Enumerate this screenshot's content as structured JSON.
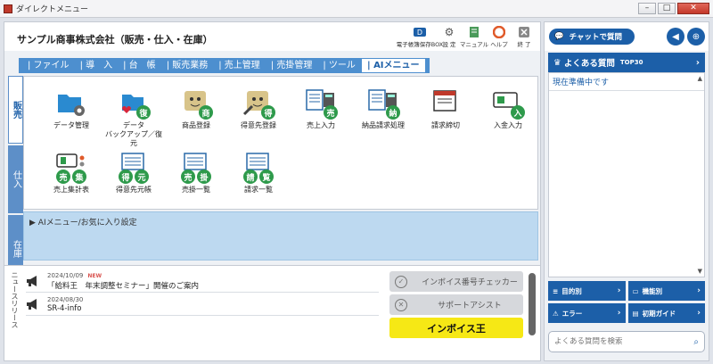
{
  "window": {
    "title": "ダイレクトメニュー",
    "buttons": [
      "–",
      "□",
      "✕"
    ]
  },
  "header": {
    "company": "サンプル商事株式会社（販売・仕入・在庫）",
    "tools": [
      {
        "label": "電子帳簿保存BOX",
        "icon": "storage-icon"
      },
      {
        "label": "設 定",
        "icon": "gear-icon"
      },
      {
        "label": "マニュアル",
        "icon": "manual-icon"
      },
      {
        "label": "ヘルプ",
        "icon": "lifebuoy-icon"
      },
      {
        "label": "終 了",
        "icon": "close-icon"
      }
    ]
  },
  "tabs": [
    {
      "label": "| ファイル"
    },
    {
      "label": "| 導　入"
    },
    {
      "label": "| 台　帳"
    },
    {
      "label": "| 販売業務"
    },
    {
      "label": "| 売上管理"
    },
    {
      "label": "| 売掛管理"
    },
    {
      "label": "| ツール"
    },
    {
      "label": "| AIメニュー"
    }
  ],
  "vtabs": [
    {
      "label": "販売"
    },
    {
      "label": "仕入"
    },
    {
      "label": "在庫"
    }
  ],
  "menu_icons": [
    {
      "label": "データ管理",
      "badge": "",
      "icon": "folder-gear-icon"
    },
    {
      "label": "データ\nバックアップ／復元",
      "badge": "復",
      "icon": "folder-backup-icon"
    },
    {
      "label": "商品登録",
      "badge": "商",
      "icon": "product-icon"
    },
    {
      "label": "得意先登録",
      "badge": "得",
      "icon": "customer-icon"
    },
    {
      "label": "売上入力",
      "badge": "売",
      "icon": "sales-input-icon"
    },
    {
      "label": "納品請求処理",
      "badge": "納",
      "icon": "delivery-icon"
    },
    {
      "label": "請求締切",
      "badge": "",
      "icon": "billing-close-icon"
    },
    {
      "label": "入金入力",
      "badge": "入",
      "icon": "payment-icon"
    },
    {
      "label": "売上集計表",
      "badge": "売集",
      "icon": "sales-summary-icon"
    },
    {
      "label": "得意先元帳",
      "badge": "得元",
      "icon": "ledger-icon"
    },
    {
      "label": "売掛一覧",
      "badge": "売掛",
      "icon": "receivable-icon"
    },
    {
      "label": "請求一覧",
      "badge": "請覧",
      "icon": "invoice-list-icon"
    }
  ],
  "fav": {
    "label": "▶ AIメニュー/お気に入り設定"
  },
  "news": {
    "side_label": "ニュースリリース",
    "items": [
      {
        "date": "2024/10/09",
        "new": "NEW",
        "title": "「給料王　年末調整セミナー」開催のご案内"
      },
      {
        "date": "2024/08/30",
        "new": "",
        "title": "SR-4-info"
      }
    ]
  },
  "actions": [
    {
      "label": "インボイス番号チェッカー",
      "icon": "check-icon"
    },
    {
      "label": "サポートアシスト",
      "icon": "support-icon"
    },
    {
      "label": "インボイス王",
      "icon": ""
    }
  ],
  "help": {
    "chat_label": "チャットで質問",
    "faq_title": "よくある質問",
    "faq_top": "TOP30",
    "faq_message": "現在準備中です",
    "grid": [
      {
        "label": "目的別"
      },
      {
        "label": "機能別"
      },
      {
        "label": "エラー"
      },
      {
        "label": "初期ガイド"
      }
    ],
    "search_placeholder": "よくある質問を検索"
  },
  "colors": {
    "accent": "#1c5fa8",
    "tab_blue": "#4d8fcf",
    "badge_green": "#2e9a4b",
    "fav_bg": "#bdd9f0",
    "invoice_yellow": "#f6e815"
  }
}
